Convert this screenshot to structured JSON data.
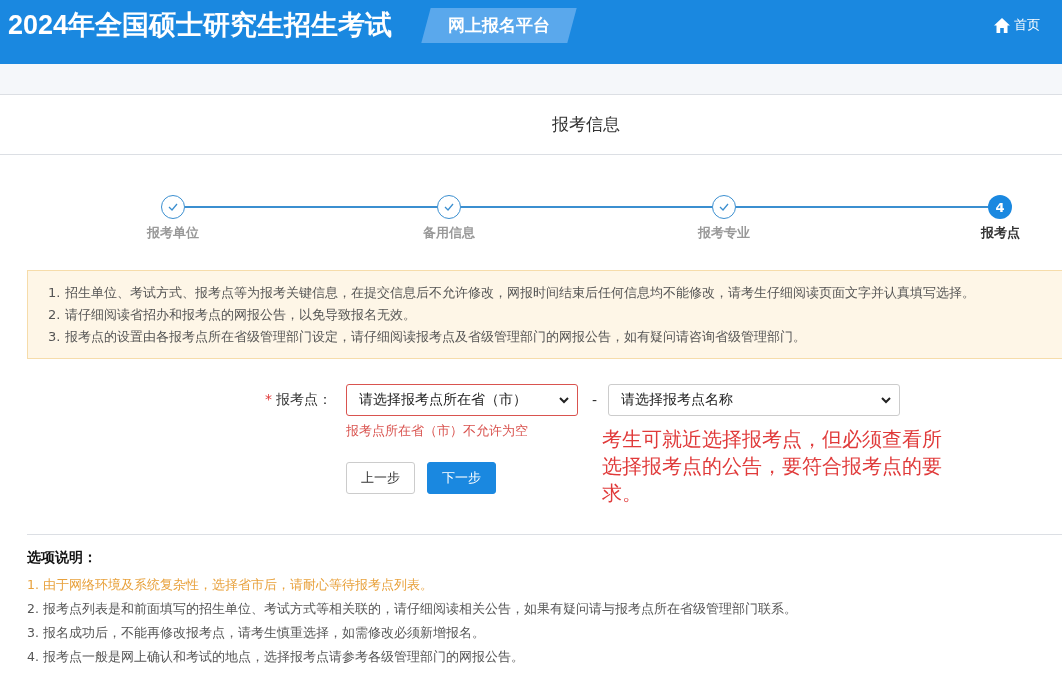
{
  "header": {
    "title": "2024年全国硕士研究生招生考试",
    "platform": "网上报名平台",
    "home_link": "首页"
  },
  "section_title": "报考信息",
  "steps": [
    {
      "label": "报考单位",
      "completed": true,
      "selected": false
    },
    {
      "label": "备用信息",
      "completed": true,
      "selected": false
    },
    {
      "label": "报考专业",
      "completed": true,
      "selected": false
    },
    {
      "label": "报考点",
      "completed": false,
      "selected": true,
      "number": "4"
    }
  ],
  "notice": [
    "1. 招生单位、考试方式、报考点等为报考关键信息，在提交信息后不允许修改，网报时间结束后任何信息均不能修改，请考生仔细阅读页面文字并认真填写选择。",
    "2. 请仔细阅读省招办和报考点的网报公告，以免导致报名无效。",
    "3. 报考点的设置由各报考点所在省级管理部门设定，请仔细阅读报考点及省级管理部门的网报公告，如有疑问请咨询省级管理部门。"
  ],
  "form": {
    "required_mark": "*",
    "label": "报考点：",
    "province_select": {
      "placeholder": "请选择报考点所在省（市）",
      "invalid": true
    },
    "separator": "-",
    "site_select": {
      "placeholder": "请选择报考点名称",
      "invalid": false
    },
    "error": "报考点所在省（市）不允许为空"
  },
  "annotation": "考生可就近选择报考点，但必须查看所选择报考点的公告，要符合报考点的要求。",
  "buttons": [
    {
      "label": "上一步",
      "primary": false
    },
    {
      "label": "下一步",
      "primary": true
    }
  ],
  "options": {
    "title": "选项说明：",
    "items": [
      {
        "text": "1. 由于网络环境及系统复杂性，选择省市后，请耐心等待报考点列表。",
        "highlighted": true
      },
      {
        "text": "2. 报考点列表是和前面填写的招生单位、考试方式等相关联的，请仔细阅读相关公告，如果有疑问请与报考点所在省级管理部门联系。",
        "highlighted": false
      },
      {
        "text": "3. 报名成功后，不能再修改报考点，请考生慎重选择，如需修改必须新增报名。",
        "highlighted": false
      },
      {
        "text": "4. 报考点一般是网上确认和考试的地点，选择报考点请参考各级管理部门的网报公告。",
        "highlighted": false
      }
    ]
  }
}
